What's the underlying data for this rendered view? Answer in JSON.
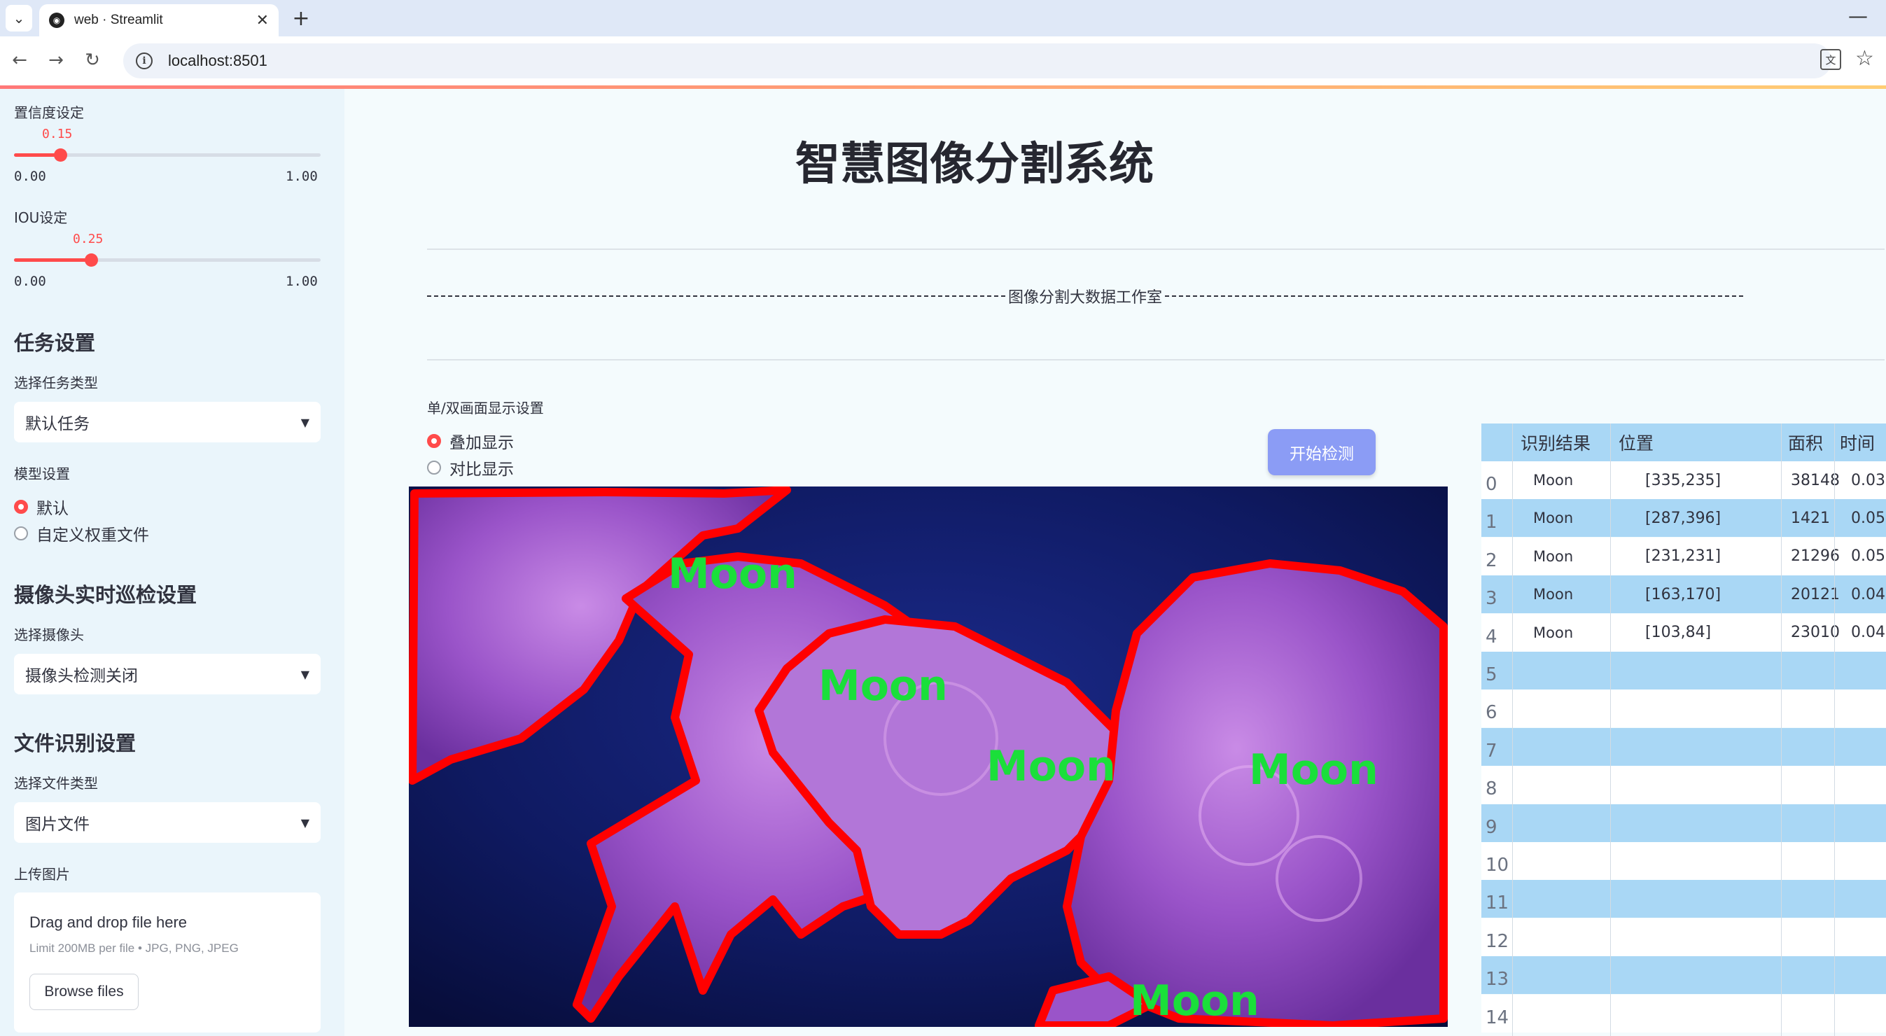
{
  "browser": {
    "tab_title": "web · Streamlit",
    "url": "localhost:8501"
  },
  "sidebar": {
    "confidence": {
      "label": "置信度设定",
      "value": 0.15,
      "value_text": "0.15",
      "min": "0.00",
      "max": "1.00"
    },
    "iou": {
      "label": "IOU设定",
      "value": 0.25,
      "value_text": "0.25",
      "min": "0.00",
      "max": "1.00"
    },
    "task_heading": "任务设置",
    "task_type_label": "选择任务类型",
    "task_type_value": "默认任务",
    "model_label": "模型设置",
    "model_options": [
      "默认",
      "自定义权重文件"
    ],
    "camera_heading": "摄像头实时巡检设置",
    "camera_label": "选择摄像头",
    "camera_value": "摄像头检测关闭",
    "file_heading": "文件识别设置",
    "file_type_label": "选择文件类型",
    "file_type_value": "图片文件",
    "upload_label": "上传图片",
    "upload_title": "Drag and drop file here",
    "upload_limit": "Limit 200MB per file • JPG, PNG, JPEG",
    "browse_label": "Browse files"
  },
  "main": {
    "title": "智慧图像分割系统",
    "studio": "图像分割大数据工作室",
    "display_label": "单/双画面显示设置",
    "display_options": [
      "叠加显示",
      "对比显示"
    ],
    "start_button": "开始检测",
    "detections": [
      "Moon",
      "Moon",
      "Moon",
      "Moon",
      "Moon"
    ]
  },
  "colors": {
    "accent": "#ff4b4b",
    "sidebar_bg": "#eaf5fb",
    "main_bg": "#f4fbfd",
    "table_stripe": "#a9d7f5",
    "button": "#8b9cf5",
    "mask_outline": "#ff0000",
    "label_text": "#1adf3a"
  },
  "table": {
    "columns": [
      "",
      "识别结果",
      "位置",
      "面积",
      "时间"
    ],
    "rows": [
      {
        "index": "0",
        "result": "Moon",
        "position": "[335,235]",
        "area": "38148",
        "time": "0.03"
      },
      {
        "index": "1",
        "result": "Moon",
        "position": "[287,396]",
        "area": "1421",
        "time": "0.05"
      },
      {
        "index": "2",
        "result": "Moon",
        "position": "[231,231]",
        "area": "21296",
        "time": "0.05"
      },
      {
        "index": "3",
        "result": "Moon",
        "position": "[163,170]",
        "area": "20121",
        "time": "0.04"
      },
      {
        "index": "4",
        "result": "Moon",
        "position": "[103,84]",
        "area": "23010",
        "time": "0.04"
      },
      {
        "index": "5",
        "result": "",
        "position": "",
        "area": "",
        "time": ""
      },
      {
        "index": "6",
        "result": "",
        "position": "",
        "area": "",
        "time": ""
      },
      {
        "index": "7",
        "result": "",
        "position": "",
        "area": "",
        "time": ""
      },
      {
        "index": "8",
        "result": "",
        "position": "",
        "area": "",
        "time": ""
      },
      {
        "index": "9",
        "result": "",
        "position": "",
        "area": "",
        "time": ""
      },
      {
        "index": "10",
        "result": "",
        "position": "",
        "area": "",
        "time": ""
      },
      {
        "index": "11",
        "result": "",
        "position": "",
        "area": "",
        "time": ""
      },
      {
        "index": "12",
        "result": "",
        "position": "",
        "area": "",
        "time": ""
      },
      {
        "index": "13",
        "result": "",
        "position": "",
        "area": "",
        "time": ""
      },
      {
        "index": "14",
        "result": "",
        "position": "",
        "area": "",
        "time": ""
      }
    ]
  }
}
